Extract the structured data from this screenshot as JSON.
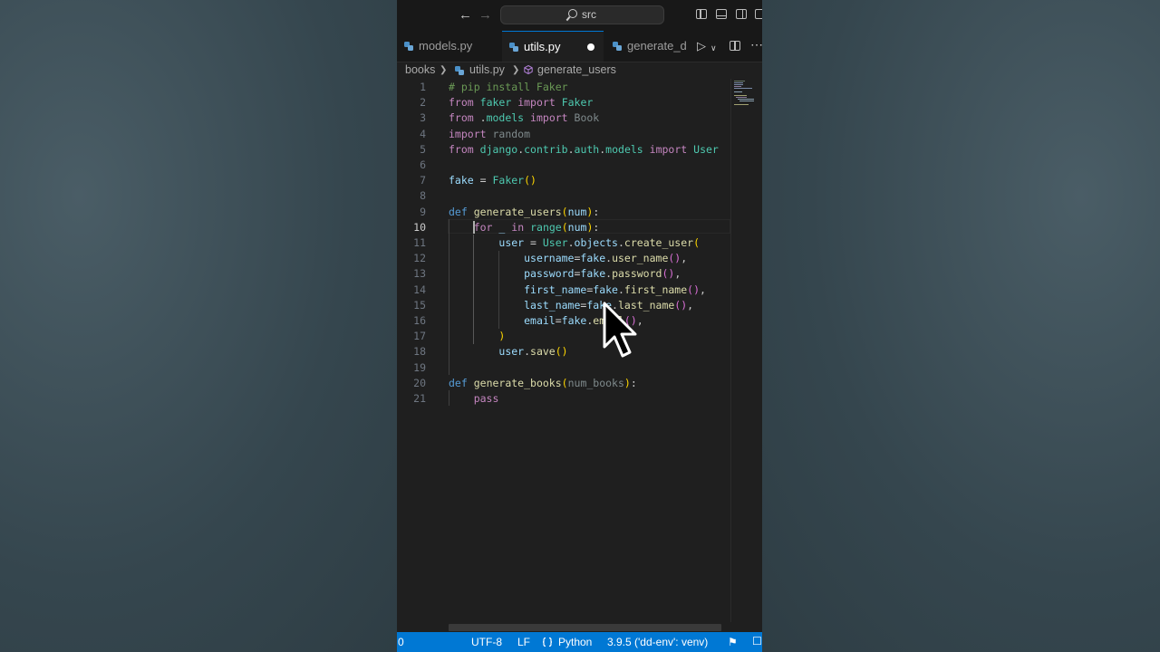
{
  "titlebar": {
    "search": "src"
  },
  "tabs": [
    {
      "label": "models.py"
    },
    {
      "label": "utils.py"
    },
    {
      "label": "generate_d"
    }
  ],
  "breadcrumb": [
    "books",
    "utils.py",
    "generate_users"
  ],
  "editor": {
    "current_line": 10,
    "lines": [
      {
        "n": "1",
        "parts": [
          [
            "cm",
            "# pip install Faker"
          ]
        ]
      },
      {
        "n": "2",
        "parts": [
          [
            "kw-ctrl",
            "from"
          ],
          [
            "pl",
            " "
          ],
          [
            "cls",
            "faker"
          ],
          [
            "pl",
            " "
          ],
          [
            "kw-ctrl",
            "import"
          ],
          [
            "pl",
            " "
          ],
          [
            "cls",
            "Faker"
          ]
        ]
      },
      {
        "n": "3",
        "parts": [
          [
            "kw-ctrl",
            "from"
          ],
          [
            "pl",
            " ."
          ],
          [
            "cls",
            "models"
          ],
          [
            "pl",
            " "
          ],
          [
            "kw-ctrl",
            "import"
          ],
          [
            "pl",
            " "
          ],
          [
            "dim",
            "Book"
          ]
        ]
      },
      {
        "n": "4",
        "parts": [
          [
            "kw-ctrl",
            "import"
          ],
          [
            "pl",
            " "
          ],
          [
            "dim",
            "random"
          ]
        ]
      },
      {
        "n": "5",
        "parts": [
          [
            "kw-ctrl",
            "from"
          ],
          [
            "pl",
            " "
          ],
          [
            "cls",
            "django"
          ],
          [
            "pl",
            "."
          ],
          [
            "cls",
            "contrib"
          ],
          [
            "pl",
            "."
          ],
          [
            "cls",
            "auth"
          ],
          [
            "pl",
            "."
          ],
          [
            "cls",
            "models"
          ],
          [
            "pl",
            " "
          ],
          [
            "kw-ctrl",
            "import"
          ],
          [
            "pl",
            " "
          ],
          [
            "cls",
            "User"
          ]
        ]
      },
      {
        "n": "6",
        "parts": []
      },
      {
        "n": "7",
        "parts": [
          [
            "var",
            "fake"
          ],
          [
            "pl",
            " = "
          ],
          [
            "cls",
            "Faker"
          ],
          [
            "pn1",
            "()"
          ]
        ]
      },
      {
        "n": "8",
        "parts": []
      },
      {
        "n": "9",
        "parts": [
          [
            "kw",
            "def"
          ],
          [
            "pl",
            " "
          ],
          [
            "fn",
            "generate_users"
          ],
          [
            "pn1",
            "("
          ],
          [
            "var",
            "num"
          ],
          [
            "pn1",
            ")"
          ],
          [
            "pl",
            ":"
          ]
        ]
      },
      {
        "n": "10",
        "parts": [
          [
            "pl",
            "    "
          ],
          [
            "kw-ctrl",
            "for"
          ],
          [
            "pl",
            " "
          ],
          [
            "var",
            "_"
          ],
          [
            "pl",
            " "
          ],
          [
            "kw-ctrl",
            "in"
          ],
          [
            "pl",
            " "
          ],
          [
            "cls",
            "range"
          ],
          [
            "pn1",
            "("
          ],
          [
            "var",
            "num"
          ],
          [
            "pn1",
            ")"
          ],
          [
            "pl",
            ":"
          ]
        ]
      },
      {
        "n": "11",
        "parts": [
          [
            "pl",
            "        "
          ],
          [
            "var",
            "user"
          ],
          [
            "pl",
            " = "
          ],
          [
            "cls",
            "User"
          ],
          [
            "pl",
            "."
          ],
          [
            "var",
            "objects"
          ],
          [
            "pl",
            "."
          ],
          [
            "fn",
            "create_user"
          ],
          [
            "pn1",
            "("
          ]
        ]
      },
      {
        "n": "12",
        "parts": [
          [
            "pl",
            "            "
          ],
          [
            "var",
            "username"
          ],
          [
            "pl",
            "="
          ],
          [
            "var",
            "fake"
          ],
          [
            "pl",
            "."
          ],
          [
            "fn",
            "user_name"
          ],
          [
            "pn2",
            "()"
          ],
          [
            "pl",
            ","
          ]
        ]
      },
      {
        "n": "13",
        "parts": [
          [
            "pl",
            "            "
          ],
          [
            "var",
            "password"
          ],
          [
            "pl",
            "="
          ],
          [
            "var",
            "fake"
          ],
          [
            "pl",
            "."
          ],
          [
            "fn",
            "password"
          ],
          [
            "pn2",
            "()"
          ],
          [
            "pl",
            ","
          ]
        ]
      },
      {
        "n": "14",
        "parts": [
          [
            "pl",
            "            "
          ],
          [
            "var",
            "first_name"
          ],
          [
            "pl",
            "="
          ],
          [
            "var",
            "fake"
          ],
          [
            "pl",
            "."
          ],
          [
            "fn",
            "first_name"
          ],
          [
            "pn2",
            "()"
          ],
          [
            "pl",
            ","
          ]
        ]
      },
      {
        "n": "15",
        "parts": [
          [
            "pl",
            "            "
          ],
          [
            "var",
            "last_name"
          ],
          [
            "pl",
            "="
          ],
          [
            "var",
            "fake"
          ],
          [
            "pl",
            "."
          ],
          [
            "fn",
            "last_name"
          ],
          [
            "pn2",
            "()"
          ],
          [
            "pl",
            ","
          ]
        ]
      },
      {
        "n": "16",
        "parts": [
          [
            "pl",
            "            "
          ],
          [
            "var",
            "email"
          ],
          [
            "pl",
            "="
          ],
          [
            "var",
            "fake"
          ],
          [
            "pl",
            "."
          ],
          [
            "fn",
            "email"
          ],
          [
            "pn2",
            "()"
          ],
          [
            "pl",
            ","
          ]
        ]
      },
      {
        "n": "17",
        "parts": [
          [
            "pl",
            "        "
          ],
          [
            "pn1",
            ")"
          ]
        ]
      },
      {
        "n": "18",
        "parts": [
          [
            "pl",
            "        "
          ],
          [
            "var",
            "user"
          ],
          [
            "pl",
            "."
          ],
          [
            "fn",
            "save"
          ],
          [
            "pn1",
            "()"
          ]
        ]
      },
      {
        "n": "19",
        "parts": []
      },
      {
        "n": "20",
        "parts": [
          [
            "kw",
            "def"
          ],
          [
            "pl",
            " "
          ],
          [
            "fn",
            "generate_books"
          ],
          [
            "pn1",
            "("
          ],
          [
            "dim",
            "num_books"
          ],
          [
            "pn1",
            ")"
          ],
          [
            "pl",
            ":"
          ]
        ]
      },
      {
        "n": "21",
        "parts": [
          [
            "pl",
            "    "
          ],
          [
            "kw-ctrl",
            "pass"
          ]
        ]
      }
    ]
  },
  "statusbar": {
    "warnings": "0",
    "encoding": "UTF-8",
    "eol": "LF",
    "language": "Python",
    "interpreter": "3.9.5 ('dd-env': venv)"
  },
  "icons": {
    "back": "arrow-left-icon",
    "forward": "arrow-right-icon",
    "search": "search-icon",
    "python": "python-icon",
    "run": "run-icon",
    "more": "ellipsis-icon",
    "feedback": "feedback-icon",
    "bell": "bell-icon",
    "pointer": "mouse-pointer-icon"
  },
  "colors": {
    "accent": "#0078d4",
    "editor_bg": "#1f1f1f",
    "backdrop": "#3d5058"
  }
}
